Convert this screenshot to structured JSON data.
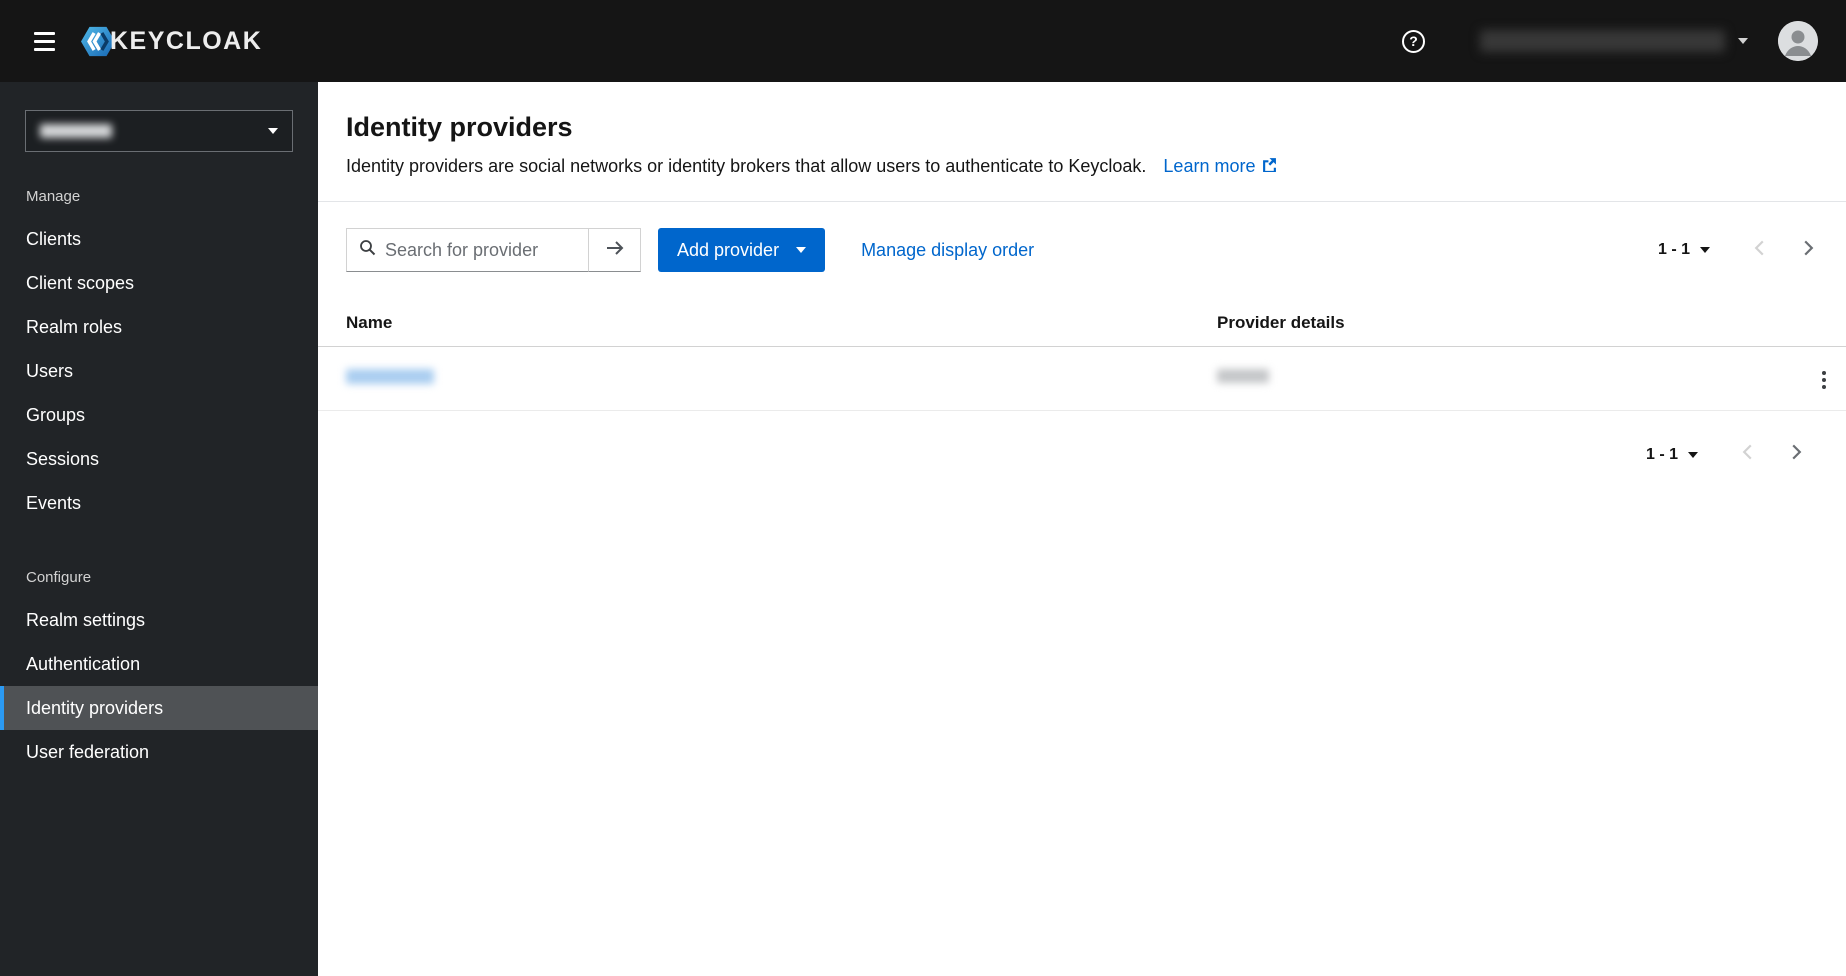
{
  "colors": {
    "masthead-bg": "#151515",
    "sidebar-bg": "#212427",
    "sidebar-selected-bg": "#4f5255",
    "sidebar-selected-border": "#2b9af3",
    "accent": "#0066cc",
    "text-dark": "#151515",
    "text-muted": "#6a6e73"
  },
  "header": {
    "brand": "KEYCLOAK",
    "help_glyph": "?"
  },
  "sidebar": {
    "active_item": "Identity providers",
    "manage": {
      "label": "Manage",
      "items": [
        "Clients",
        "Client scopes",
        "Realm roles",
        "Users",
        "Groups",
        "Sessions",
        "Events"
      ]
    },
    "configure": {
      "label": "Configure",
      "items": [
        "Realm settings",
        "Authentication",
        "Identity providers",
        "User federation"
      ]
    }
  },
  "main": {
    "title": "Identity providers",
    "description": "Identity providers are social networks or identity brokers that allow users to authenticate to Keycloak.",
    "learn_more": "Learn more",
    "toolbar": {
      "search_placeholder": "Search for provider",
      "add_provider": "Add provider",
      "manage_display_order": "Manage display order"
    },
    "table": {
      "columns": [
        "Name",
        "Provider details"
      ]
    },
    "pagination_top": "1 - 1",
    "pagination_bottom": "1 - 1"
  }
}
